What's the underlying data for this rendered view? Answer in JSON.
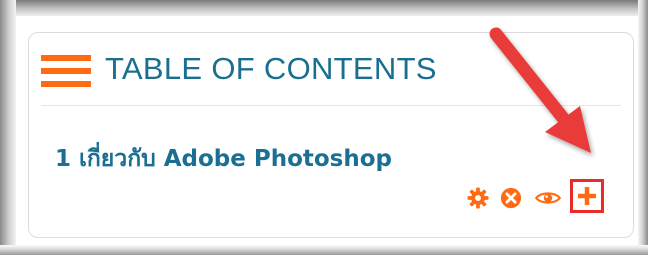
{
  "toc": {
    "title": "TABLE OF CONTENTS",
    "chapter_link": "1 เกี่ยวกับ Adobe Photoshop"
  },
  "actions": {
    "edit_icon": "gear-icon",
    "delete_icon": "x-circle-icon",
    "view_icon": "eye-icon",
    "add_icon": "plus-icon"
  },
  "colors": {
    "accent_orange": "#ff6a13",
    "title_blue": "#1a6f8f",
    "highlight_red": "#ec2a2a"
  }
}
